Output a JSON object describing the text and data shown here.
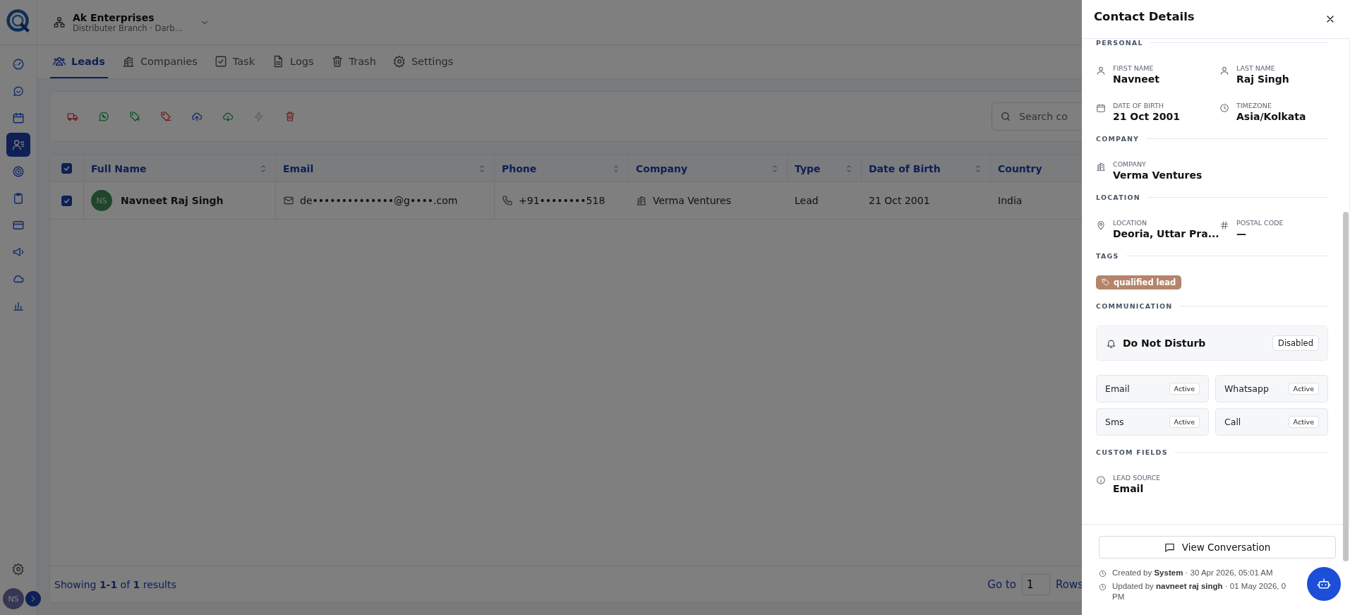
{
  "org": {
    "name": "Ak Enterprises",
    "subtitle": "Distributer Branch · Darb…"
  },
  "sidebar": {
    "items": [
      {
        "selected": false
      },
      {
        "selected": false
      },
      {
        "selected": false
      },
      {
        "selected": true
      },
      {
        "selected": false
      },
      {
        "selected": false
      },
      {
        "selected": false
      },
      {
        "selected": false
      },
      {
        "selected": false
      },
      {
        "selected": false
      }
    ],
    "avatar": "NS"
  },
  "tabs": [
    {
      "label": "Leads",
      "selected": true
    },
    {
      "label": "Companies",
      "selected": false
    },
    {
      "label": "Task",
      "selected": false
    },
    {
      "label": "Logs",
      "selected": false
    },
    {
      "label": "Trash",
      "selected": false
    },
    {
      "label": "Settings",
      "selected": false
    }
  ],
  "toolbar": {
    "actions": [
      {
        "disabled": false
      },
      {
        "disabled": false
      },
      {
        "disabled": false
      },
      {
        "disabled": false
      },
      {
        "disabled": false
      },
      {
        "disabled": false
      },
      {
        "disabled": true
      },
      {
        "disabled": false
      }
    ],
    "search": {
      "placeholder": "Search co"
    }
  },
  "table": {
    "all_checked": true,
    "columns": [
      "Full Name",
      "Email",
      "Phone",
      "Company",
      "Type",
      "Date of Birth",
      "Country"
    ],
    "rows": [
      {
        "selected": true,
        "initials": "NS",
        "name": "Navneet Raj Singh",
        "email": "de••••••••••••••@g••••.com",
        "phone": "+91••••••••518",
        "company": "Verma Ventures",
        "type": "Lead",
        "dob": "21 Oct 2001",
        "country": "India"
      }
    ]
  },
  "footer": {
    "summary": "Showing **1-1** of **1** results",
    "goto_label": "Go to",
    "goto_value": "1",
    "rows_label": "Rows"
  },
  "drawer": {
    "title": "Contact Details",
    "sections": [
      {
        "kind": "fields",
        "title": "PERSONAL",
        "fields": [
          {
            "label": "FIRST NAME",
            "value": "Navneet"
          },
          {
            "label": "LAST NAME",
            "value": "Raj Singh"
          },
          {
            "label": "DATE OF BIRTH",
            "value": "21 Oct 2001"
          },
          {
            "label": "TIMEZONE",
            "value": "Asia/Kolkata"
          }
        ]
      },
      {
        "kind": "fields",
        "title": "COMPANY",
        "fields": [
          {
            "label": "COMPANY",
            "value": "Verma Ventures"
          }
        ]
      },
      {
        "kind": "fields",
        "title": "LOCATION",
        "fields": [
          {
            "label": "LOCATION",
            "value": "Deoria, Uttar Pra..."
          },
          {
            "label": "POSTAL CODE",
            "value": "—"
          }
        ]
      },
      {
        "kind": "tags",
        "title": "TAGS",
        "tags": [
          {
            "label": "qualified lead",
            "color": "#b5846a"
          }
        ]
      },
      {
        "kind": "communication",
        "title": "COMMUNICATION",
        "dnd": {
          "label": "Do Not Disturb",
          "status": "Disabled",
          "on": false
        },
        "channels": [
          {
            "name": "Email",
            "status": "Active",
            "active": true
          },
          {
            "name": "Whatsapp",
            "status": "Active",
            "active": true
          },
          {
            "name": "Sms",
            "status": "Active",
            "active": true
          },
          {
            "name": "Call",
            "status": "Active",
            "active": true
          }
        ]
      },
      {
        "kind": "fields",
        "title": "CUSTOM FIELDS",
        "fields": [
          {
            "label": "LEAD SOURCE",
            "value": "Email"
          }
        ]
      }
    ],
    "button": "View Conversation",
    "created": "Created by **System** · 30 Apr 2026, 05:01 AM",
    "updated": "Updated by **navneet raj singh** · 01 May 2026, 0",
    "updated_tail": "PM"
  }
}
